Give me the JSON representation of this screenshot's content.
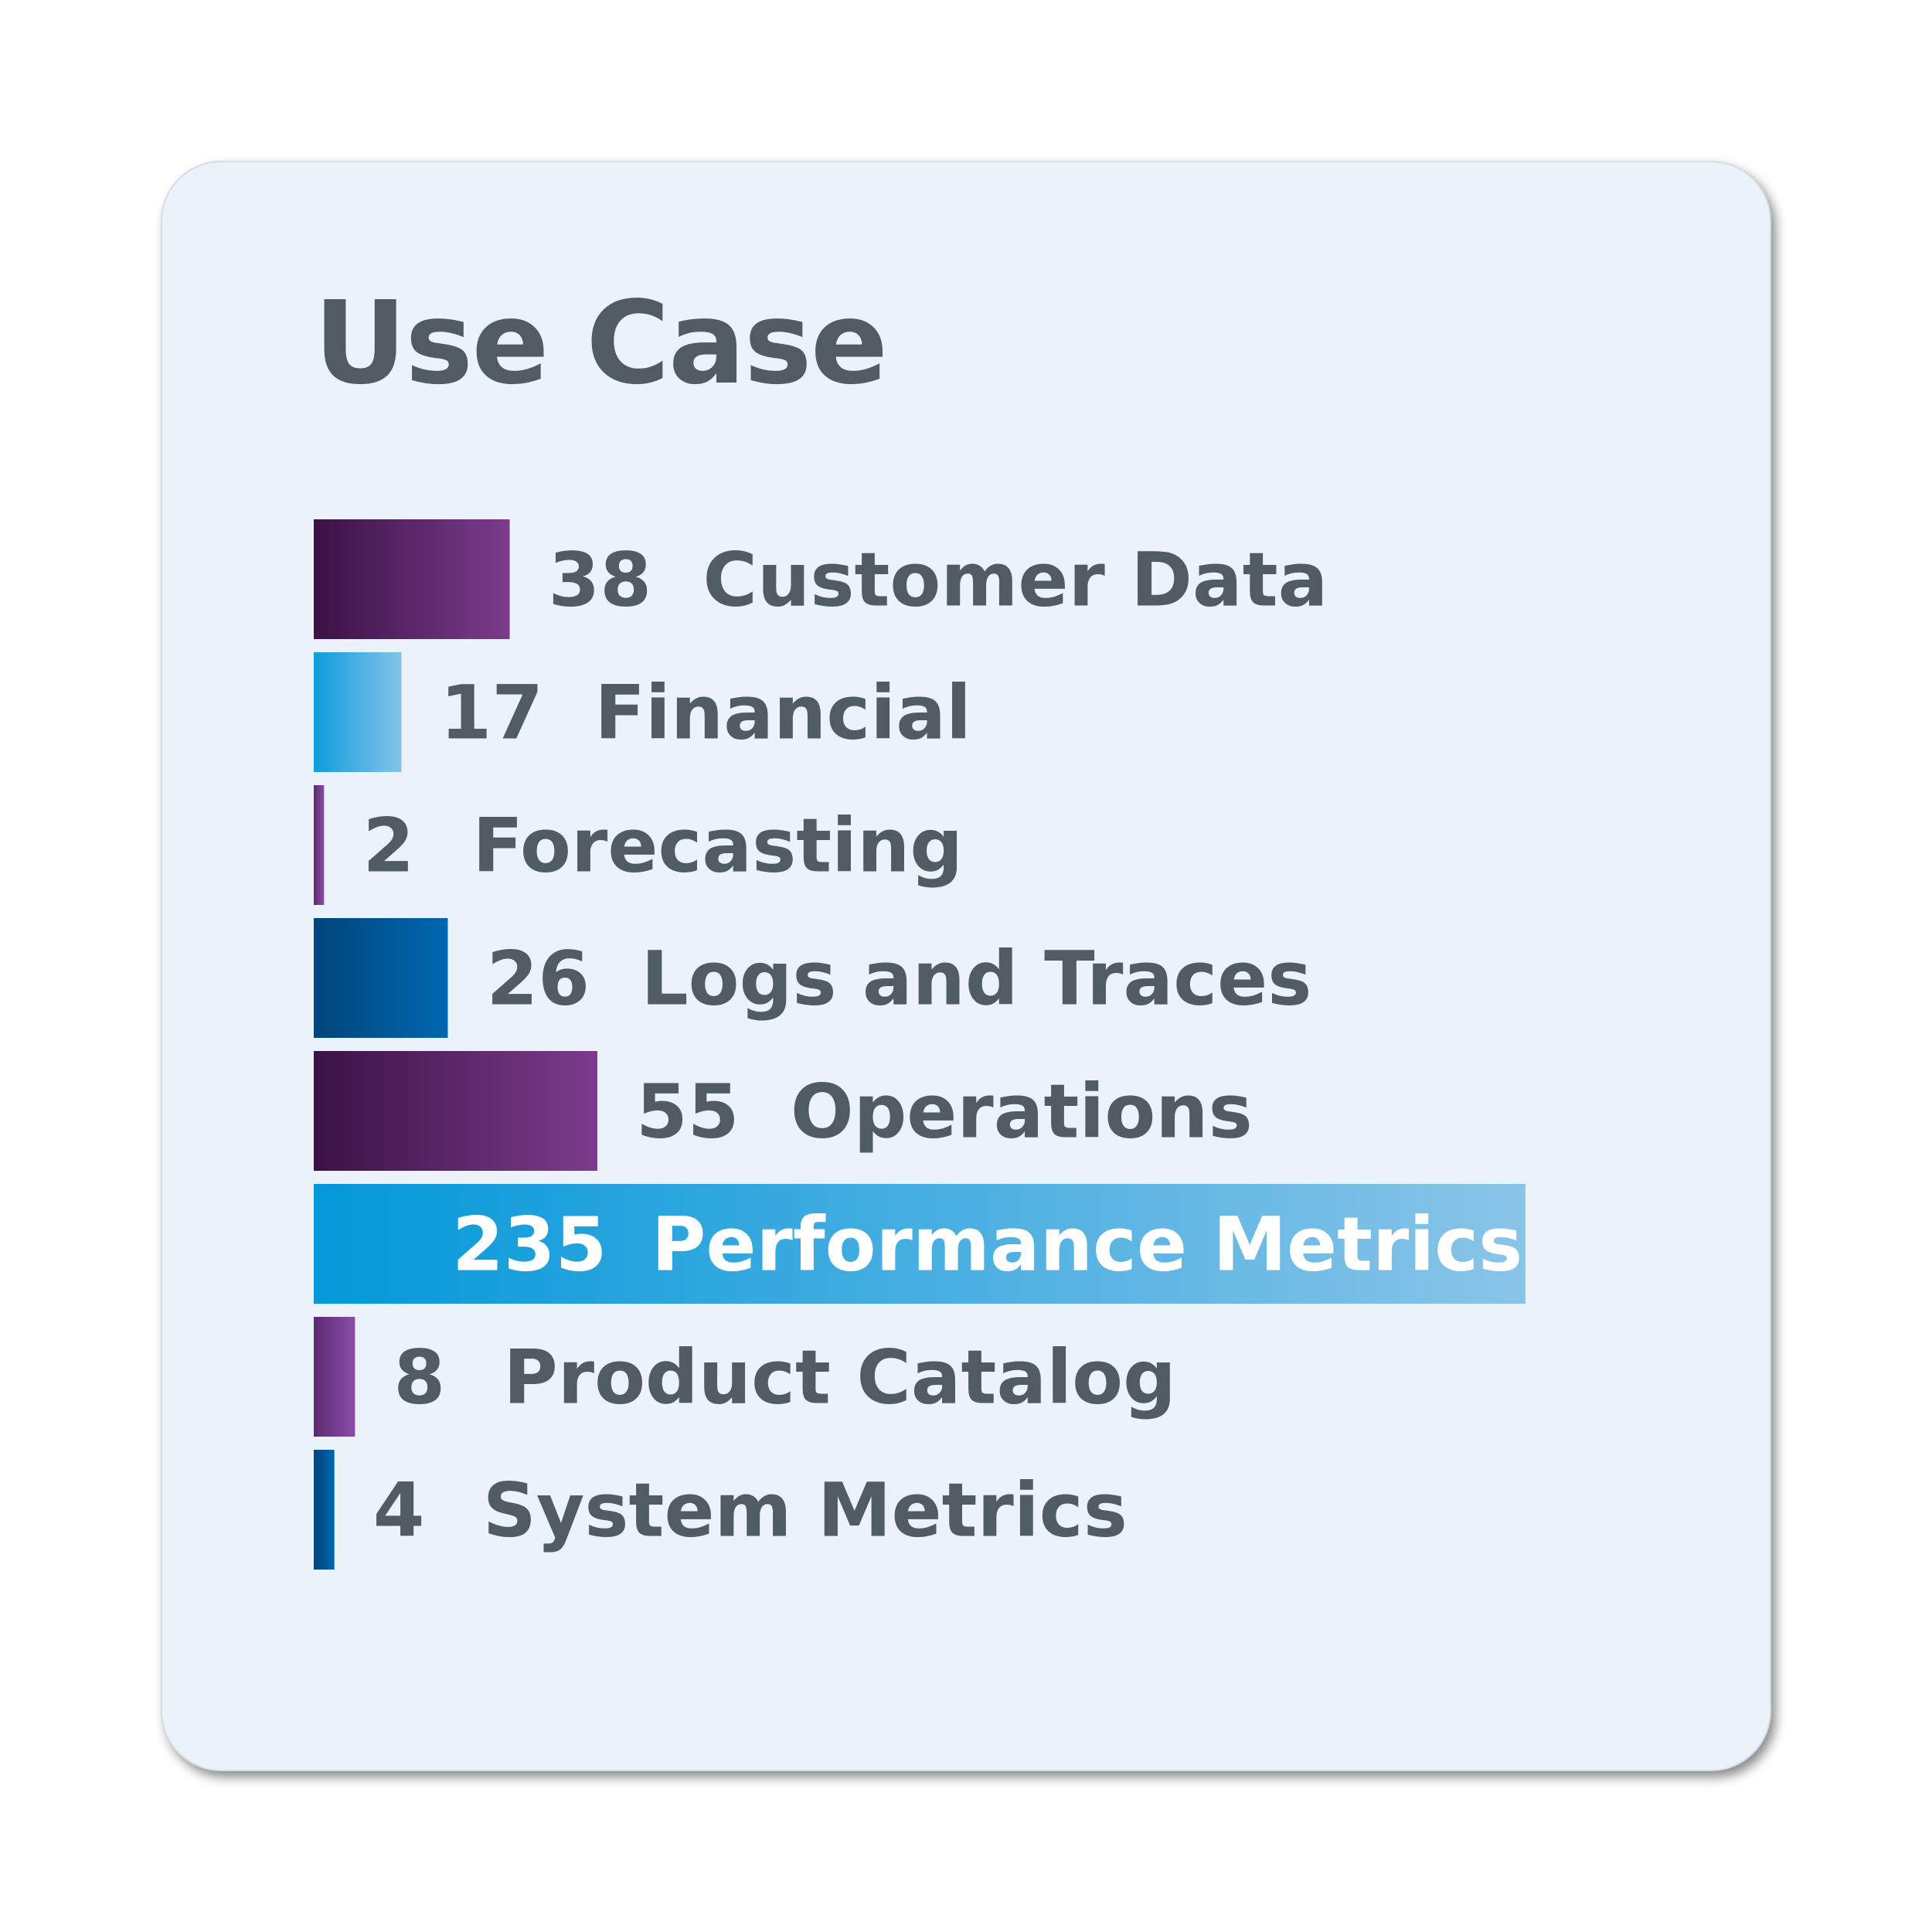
{
  "chart_data": {
    "type": "bar",
    "orientation": "horizontal",
    "title": "Use Case",
    "categories": [
      "Customer Data",
      "Financial",
      "Forecasting",
      "Logs and Traces",
      "Operations",
      "Performance Metrics",
      "Product Catalog",
      "System Metrics"
    ],
    "values": [
      38,
      17,
      2,
      26,
      55,
      235,
      8,
      4
    ],
    "highlighted_category": "Performance Metrics",
    "bar_gradients": [
      [
        "#3b1245",
        "#7b3c8c"
      ],
      [
        "#0c9ddc",
        "#86c3e8"
      ],
      [
        "#5a2a70",
        "#8c4ca8"
      ],
      [
        "#00447a",
        "#0067b0"
      ],
      [
        "#3b1245",
        "#7b3c8c"
      ],
      [
        "#0398da",
        "#8ac4e8"
      ],
      [
        "#5a2a70",
        "#8c4ca8"
      ],
      [
        "#00447a",
        "#0067b0"
      ]
    ],
    "label_color": "#505b62",
    "highlight_label_color": "#ffffff",
    "grid": false,
    "legend": "none"
  }
}
